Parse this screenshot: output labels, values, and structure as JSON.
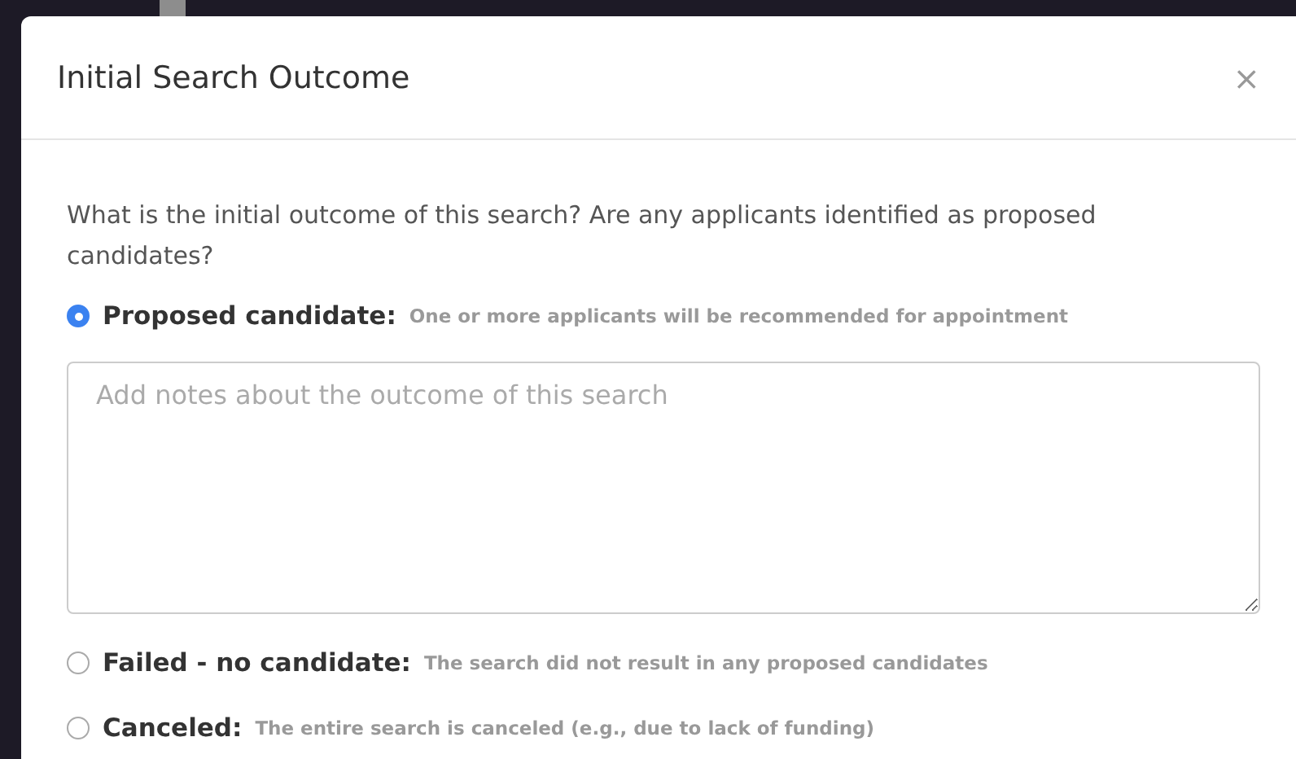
{
  "dialog": {
    "title": "Initial Search Outcome",
    "close": "×"
  },
  "question": "What is the initial outcome of this search? Are any applicants identified as proposed candidates?",
  "options": [
    {
      "label": "Proposed candidate:",
      "description": "One or more applicants will be recommended for appointment",
      "selected": true
    },
    {
      "label": "Failed - no candidate:",
      "description": "The search did not result in any proposed candidates",
      "selected": false
    },
    {
      "label": "Canceled:",
      "description": "The entire search is canceled (e.g., due to lack of funding)",
      "selected": false
    }
  ],
  "notes": {
    "placeholder": "Add notes about the outcome of this search"
  }
}
